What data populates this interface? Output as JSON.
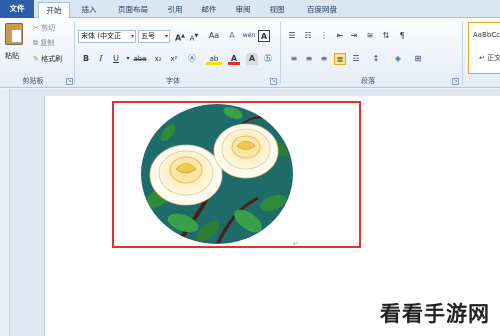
{
  "tabs": {
    "file": "文件",
    "home": "开始",
    "insert": "插入",
    "page_layout": "页面布局",
    "references": "引用",
    "mailings": "邮件",
    "review": "审阅",
    "view": "视图",
    "baidu": "百度网盘"
  },
  "clipboard": {
    "paste": "粘贴",
    "cut": "剪切",
    "copy": "复制",
    "format_painter": "格式刷",
    "group_label": "剪贴板"
  },
  "font": {
    "family": "宋体 (中文正",
    "size": "五号",
    "bold": "B",
    "italic": "I",
    "underline": "U",
    "strike": "abe",
    "subscript": "x₂",
    "superscript": "x²",
    "grow": "A",
    "shrink": "A",
    "case": "Aa",
    "clear": "A",
    "phonetic": "wén",
    "font_color": "A",
    "highlight": "ab",
    "group_label": "字体"
  },
  "paragraph": {
    "group_label": "段落"
  },
  "styles": {
    "sample": "AaBbCc",
    "name": "正文"
  },
  "document": {
    "cursor_mark": "↵"
  },
  "watermark": "看看手游网"
}
